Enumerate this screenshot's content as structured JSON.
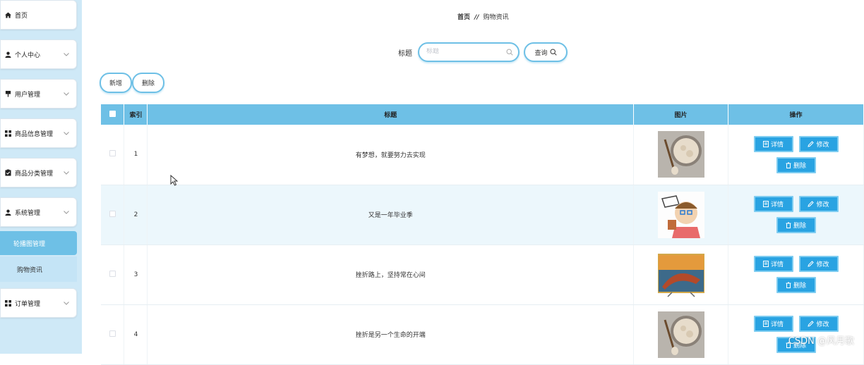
{
  "sidebar": {
    "items": [
      {
        "label": "首页",
        "icon": "home-icon",
        "expandable": false
      },
      {
        "label": "个人中心",
        "icon": "user-icon",
        "expandable": true
      },
      {
        "label": "用户管理",
        "icon": "pin-icon",
        "expandable": true
      },
      {
        "label": "商品信息管理",
        "icon": "grid-icon",
        "expandable": true
      },
      {
        "label": "商品分类管理",
        "icon": "clipboard-icon",
        "expandable": true
      },
      {
        "label": "系统管理",
        "icon": "user-icon",
        "expandable": true
      },
      {
        "label": "订单管理",
        "icon": "grid-icon",
        "expandable": true
      }
    ],
    "submenu": {
      "active": "轮播图管理",
      "item": "购物资讯"
    }
  },
  "breadcrumb": {
    "home": "首页",
    "separator": "//",
    "current": "购物资讯"
  },
  "search": {
    "label": "标题",
    "placeholder": "标题",
    "value": "",
    "query_button": "查询"
  },
  "toolbar": {
    "add_label": "新增",
    "delete_label": "删除"
  },
  "table": {
    "headers": {
      "index": "索引",
      "title": "标题",
      "image": "图片",
      "actions": "操作"
    },
    "rows": [
      {
        "index": "1",
        "title": "有梦想，就要努力去实现",
        "image": "oats-bowl"
      },
      {
        "index": "2",
        "title": "又是一年毕业季",
        "image": "cartoon-boy"
      },
      {
        "index": "3",
        "title": "挫折路上，坚持常在心间",
        "image": "boat-sunset"
      },
      {
        "index": "4",
        "title": "挫折是另一个生命的开端",
        "image": "oats-bowl"
      }
    ],
    "actions": {
      "detail": "详情",
      "edit": "修改",
      "delete": "删除"
    }
  },
  "colors": {
    "accent": "#6ec0e6",
    "button": "#29a3e2",
    "sidebar_bg": "#cfe9f7"
  },
  "watermark": "CSDN @风月歌"
}
